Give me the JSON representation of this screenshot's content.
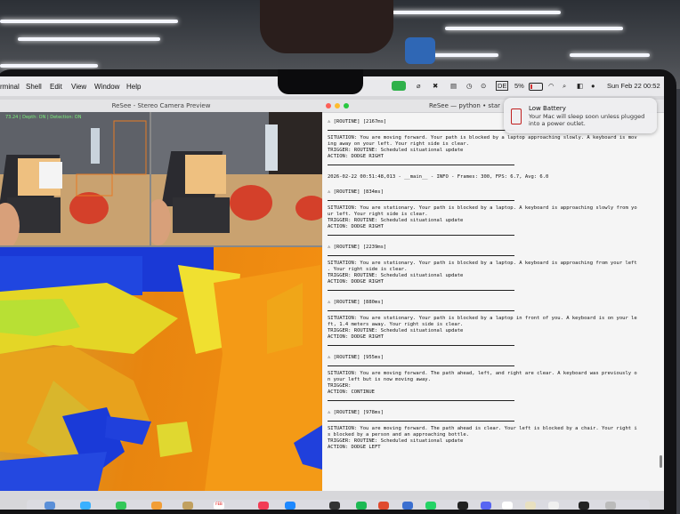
{
  "macos": {
    "menu": [
      "rminal",
      "Shell",
      "Edit",
      "View",
      "Window",
      "Help"
    ],
    "battery": "5%",
    "clock": "Sun Feb 22  00:52",
    "input_badge": "DE"
  },
  "camera_window": {
    "title": "ReSee - Stereo Camera Preview",
    "overlay": "73.24 | Depth: ON | Detection: ON"
  },
  "terminal_window": {
    "title": "ReSee — python • star",
    "entries": [
      {
        "header": "[ROUTINE] [2167ms]",
        "lines": [
          "SITUATION: You are moving forward. Your path is blocked by a laptop approaching slowly. A keyboard is mov",
          "ing away on your left. Your right side is clear.",
          "TRIGGER: ROUTINE: Scheduled situational update",
          "ACTION: DODGE RIGHT"
        ]
      },
      {
        "header": "2026-02-22 00:51:48,013 - __main__ - INFO - Frames: 300, FPS: 6.7, Avg: 6.0",
        "lines": []
      },
      {
        "header": "[ROUTINE] [834ms]",
        "lines": [
          "SITUATION: You are stationary. Your path is blocked by a laptop. A keyboard is approaching slowly from yo",
          "ur left. Your right side is clear.",
          "TRIGGER: ROUTINE: Scheduled situational update",
          "ACTION: DODGE RIGHT"
        ]
      },
      {
        "header": "[ROUTINE] [2239ms]",
        "lines": [
          "SITUATION: You are stationary. Your path is blocked by a laptop. A keyboard is approaching from your left",
          ". Your right side is clear.",
          "TRIGGER: ROUTINE: Scheduled situational update",
          "ACTION: DODGE RIGHT"
        ]
      },
      {
        "header": "[ROUTINE] [880ms]",
        "lines": [
          "SITUATION: You are stationary. Your path is blocked by a laptop in front of you. A keyboard is on your le",
          "ft, 1.4 meters away. Your right side is clear.",
          "TRIGGER: ROUTINE: Scheduled situational update",
          "ACTION: DODGE RIGHT"
        ]
      },
      {
        "header": "[ROUTINE] [955ms]",
        "lines": [
          "SITUATION: You are moving forward. The path ahead, left, and right are clear. A keyboard was previously o",
          "n your left but is now moving away.",
          "TRIGGER:",
          "ACTION: CONTINUE"
        ]
      },
      {
        "header": "[ROUTINE] [978ms]",
        "lines": [
          "SITUATION: You are moving forward. The path ahead is clear. Your left is blocked by a chair. Your right i",
          "s blocked by a person and an approaching bottle.",
          "TRIGGER: ROUTINE: Scheduled situational update",
          "ACTION: DODGE LEFT"
        ]
      }
    ]
  },
  "notification": {
    "title": "Low Battery",
    "body": "Your Mac will sleep soon unless plugged into a power outlet."
  },
  "dock": {
    "calendar_label": "FEB"
  }
}
